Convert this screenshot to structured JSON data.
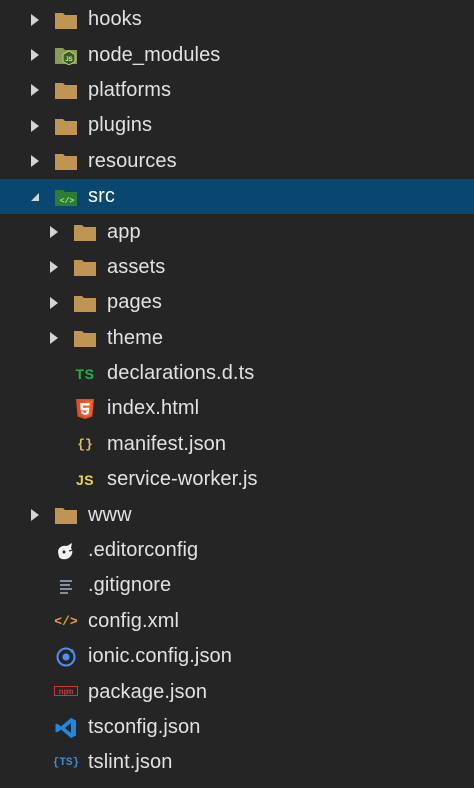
{
  "colors": {
    "background": "#252526",
    "selected_row": "#094771",
    "folder": "#c09553",
    "text": "#e2e2e2"
  },
  "tree": {
    "items": [
      {
        "label": "hooks",
        "icon": "folder-icon",
        "kind": "folder",
        "expanded": false
      },
      {
        "label": "node_modules",
        "icon": "node-folder-icon",
        "kind": "folder",
        "expanded": false
      },
      {
        "label": "platforms",
        "icon": "folder-icon",
        "kind": "folder",
        "expanded": false
      },
      {
        "label": "plugins",
        "icon": "folder-icon",
        "kind": "folder",
        "expanded": false
      },
      {
        "label": "resources",
        "icon": "folder-icon",
        "kind": "folder",
        "expanded": false
      },
      {
        "label": "src",
        "icon": "src-folder-icon",
        "kind": "folder",
        "expanded": true,
        "selected": true
      },
      {
        "label": "app",
        "icon": "folder-icon",
        "kind": "folder",
        "expanded": false
      },
      {
        "label": "assets",
        "icon": "folder-icon",
        "kind": "folder",
        "expanded": false
      },
      {
        "label": "pages",
        "icon": "folder-icon",
        "kind": "folder",
        "expanded": false
      },
      {
        "label": "theme",
        "icon": "folder-icon",
        "kind": "folder",
        "expanded": false
      },
      {
        "label": "declarations.d.ts",
        "icon": "typescript-icon",
        "kind": "file",
        "icon_text": "TS"
      },
      {
        "label": "index.html",
        "icon": "html5-icon",
        "kind": "file"
      },
      {
        "label": "manifest.json",
        "icon": "json-icon",
        "kind": "file",
        "icon_text": "{}"
      },
      {
        "label": "service-worker.js",
        "icon": "javascript-icon",
        "kind": "file",
        "icon_text": "JS"
      },
      {
        "label": "www",
        "icon": "folder-icon",
        "kind": "folder",
        "expanded": false
      },
      {
        "label": ".editorconfig",
        "icon": "editorconfig-icon",
        "kind": "file"
      },
      {
        "label": ".gitignore",
        "icon": "lines-icon",
        "kind": "file"
      },
      {
        "label": "config.xml",
        "icon": "xml-icon",
        "kind": "file",
        "icon_text": "</>"
      },
      {
        "label": "ionic.config.json",
        "icon": "ionic-icon",
        "kind": "file"
      },
      {
        "label": "package.json",
        "icon": "npm-icon",
        "kind": "file",
        "icon_text": "npm"
      },
      {
        "label": "tsconfig.json",
        "icon": "vscode-icon",
        "kind": "file"
      },
      {
        "label": "tslint.json",
        "icon": "tslint-icon",
        "kind": "file",
        "icon_text": "{TS}"
      }
    ]
  }
}
